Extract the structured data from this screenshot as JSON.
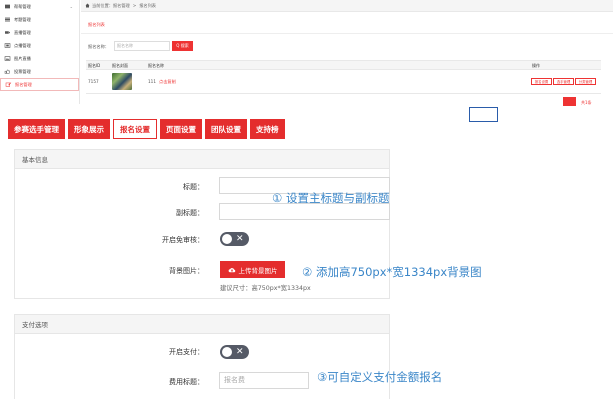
{
  "sidebar": {
    "items": [
      {
        "label": "帮帮管理",
        "icon": "building-icon",
        "chevron": "⌄"
      },
      {
        "label": "考题管理",
        "icon": "list-icon"
      },
      {
        "label": "直播管理",
        "icon": "video-icon"
      },
      {
        "label": "点播管理",
        "icon": "film-icon"
      },
      {
        "label": "图片直播",
        "icon": "image-icon"
      },
      {
        "label": "投票管理",
        "icon": "thumbs-up-icon"
      },
      {
        "label": "报名管理",
        "icon": "edit-icon",
        "active": true
      }
    ]
  },
  "breadcrumb": {
    "prefix": "当前位置：",
    "level1": "报名管理",
    "sep": ">",
    "level2": "报名列表"
  },
  "list": {
    "subtab": "报名列表",
    "search_label": "报名名称：",
    "search_placeholder": "报名名称",
    "search_button": "Q 搜索",
    "headers": {
      "id": "报名ID",
      "cover": "报名封面",
      "name": "报名名称",
      "ops": "操作"
    },
    "row": {
      "id": "7157",
      "name_prefix": "111",
      "name_link": "点击复制",
      "ops": [
        "报名设置",
        "选手管理",
        "分类管理"
      ]
    },
    "pagination_text": "共1条"
  },
  "tabs": [
    {
      "label": "参赛选手管理",
      "active": false
    },
    {
      "label": "形象展示",
      "active": false
    },
    {
      "label": "报名设置",
      "active": true
    },
    {
      "label": "页面设置",
      "active": false
    },
    {
      "label": "团队设置",
      "active": false
    },
    {
      "label": "支持榜",
      "active": false
    }
  ],
  "basic": {
    "header": "基本信息",
    "title_label": "标题：",
    "subtitle_label": "副标题：",
    "exempt_label": "开启免审核：",
    "bg_label": "背景图片：",
    "upload_button": "上传背景图片",
    "size_hint": "建议尺寸：高750px*宽1334px"
  },
  "payment": {
    "header": "支付选项",
    "enable_label": "开启支付：",
    "fee_label": "费用标题：",
    "fee_placeholder": "报名费"
  },
  "annotations": {
    "a1": "① 设置主标题与副标题",
    "a2": "② 添加高750px*宽1334px背景图",
    "a3": "③可自定义支付金额报名"
  },
  "colors": {
    "brand_red": "#e42d2d",
    "annotation_blue": "#3a86c8",
    "toggle_off": "#555a66"
  }
}
